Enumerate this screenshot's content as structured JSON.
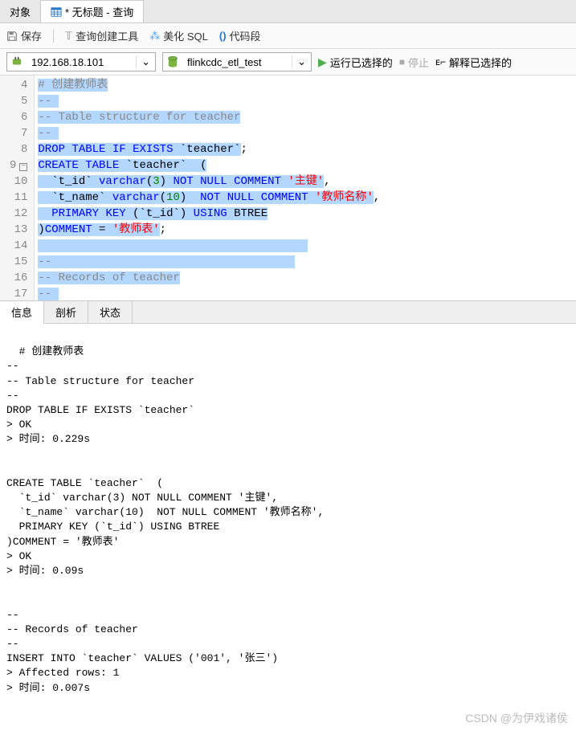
{
  "tabs": {
    "obj": "对象",
    "query": "* 无标题 - 查询"
  },
  "toolbar": {
    "save": "保存",
    "query_builder": "查询创建工具",
    "beautify": "美化 SQL",
    "snippet": "代码段"
  },
  "conn": {
    "host": "192.168.18.101",
    "db": "flinkcdc_etl_test",
    "run": "运行已选择的",
    "stop": "停止",
    "explain": "解释已选择的"
  },
  "gutter": [
    "4",
    "5",
    "6",
    "7",
    "8",
    "9",
    "10",
    "11",
    "12",
    "13",
    "14",
    "15",
    "16",
    "17"
  ],
  "code": {
    "l4_a": "# 创建教师表",
    "l5_a": "-- ",
    "l6_a": "-- Table structure for teacher",
    "l7_a": "-- ",
    "l8_kw1": "DROP",
    "l8_kw2": "TABLE",
    "l8_kw3": "IF",
    "l8_kw4": "EXISTS",
    "l8_t": " `teacher`",
    "l8_e": ";",
    "l9_kw1": "CREATE",
    "l9_kw2": "TABLE",
    "l9_t": " `teacher`  (",
    "l10_p": "  `t_id` ",
    "l10_kw1": "varchar",
    "l10_p2": "(",
    "l10_n": "3",
    "l10_p3": ") ",
    "l10_kw2": "NOT",
    "l10_kw3": "NULL",
    "l10_kw4": "COMMENT",
    "l10_s": "'主键'",
    "l10_e": ",",
    "l11_p": "  `t_name` ",
    "l11_kw1": "varchar",
    "l11_p2": "(",
    "l11_n": "10",
    "l11_p3": ")  ",
    "l11_kw2": "NOT",
    "l11_kw3": "NULL",
    "l11_kw4": "COMMENT",
    "l11_s": "'教师名称'",
    "l11_e": ",",
    "l12_p": "  ",
    "l12_kw1": "PRIMARY",
    "l12_kw2": "KEY",
    "l12_t": " (`t_id`) ",
    "l12_kw3": "USING",
    "l12_t2": " BTREE",
    "l13_p": ")",
    "l13_kw1": "COMMENT",
    "l13_t": " = ",
    "l13_s": "'教师表'",
    "l13_e": ";",
    "l15_a": "-- ",
    "l16_a": "-- Records of teacher",
    "l17_a": "-- "
  },
  "btabs": {
    "info": "信息",
    "profile": "剖析",
    "status": "状态"
  },
  "output": "# 创建教师表\n-- \n-- Table structure for teacher\n-- \nDROP TABLE IF EXISTS `teacher`\n> OK\n> 时间: 0.229s\n\n\nCREATE TABLE `teacher`  (\n  `t_id` varchar(3) NOT NULL COMMENT '主键',\n  `t_name` varchar(10)  NOT NULL COMMENT '教师名称',\n  PRIMARY KEY (`t_id`) USING BTREE\n)COMMENT = '教师表'\n> OK\n> 时间: 0.09s\n\n\n-- \n-- Records of teacher\n-- \nINSERT INTO `teacher` VALUES ('001', '张三')\n> Affected rows: 1\n> 时间: 0.007s\n",
  "watermark": "CSDN @为伊戏诸侯"
}
